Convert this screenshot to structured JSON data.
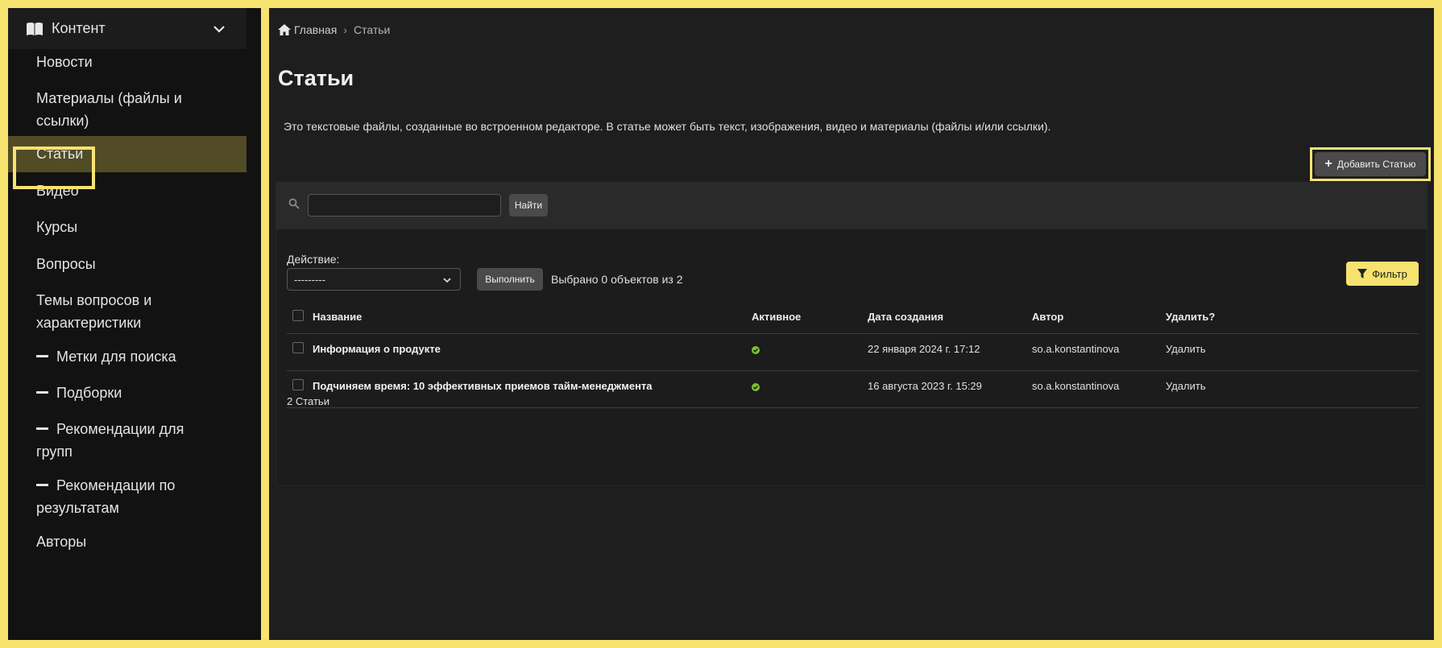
{
  "sidebar": {
    "header_label": "Контент",
    "items": [
      {
        "label": "Новости"
      },
      {
        "label": "Материалы (файлы и ссылки)"
      },
      {
        "label": "Статьи"
      },
      {
        "label": "Видео"
      },
      {
        "label": "Курсы"
      },
      {
        "label": "Вопросы"
      },
      {
        "label": "Темы вопросов и характеристики"
      },
      {
        "label": "Метки для поиска"
      },
      {
        "label": "Подборки"
      },
      {
        "label": "Рекомендации для групп"
      },
      {
        "label": "Рекомендации по результатам"
      },
      {
        "label": "Авторы"
      }
    ]
  },
  "breadcrumb": {
    "home": "Главная",
    "separator": "›",
    "current": "Статьи"
  },
  "page": {
    "title": "Статьи",
    "description": "Это текстовые файлы, созданные во встроенном редакторе. В статье может быть текст, изображения, видео и материалы (файлы и/или ссылки).",
    "add_button": "Добавить Статью"
  },
  "search": {
    "placeholder": "",
    "button": "Найти"
  },
  "actions": {
    "label": "Действие:",
    "select_value": "---------",
    "run_button": "Выполнить",
    "selected_text": "Выбрано 0 объектов из 2",
    "filter_button": "Фильтр"
  },
  "table": {
    "headers": {
      "name": "Название",
      "active": "Активное",
      "created": "Дата создания",
      "author": "Автор",
      "delete": "Удалить?"
    },
    "rows": [
      {
        "name": "Информация о продукте",
        "active": true,
        "created": "22 января 2024 г. 17:12",
        "author": "so.a.konstantinova",
        "delete": "Удалить"
      },
      {
        "name": "Подчиняем время: 10 эффективных приемов тайм-менеджмента",
        "active": true,
        "created": "16 августа 2023 г. 15:29",
        "author": "so.a.konstantinova",
        "delete": "Удалить"
      }
    ],
    "count_text": "2 Статьи"
  },
  "colors": {
    "highlight": "#f6e36f",
    "active_bg": "#514b26",
    "ok": "#7cc233",
    "arrow": "#e0304a"
  }
}
